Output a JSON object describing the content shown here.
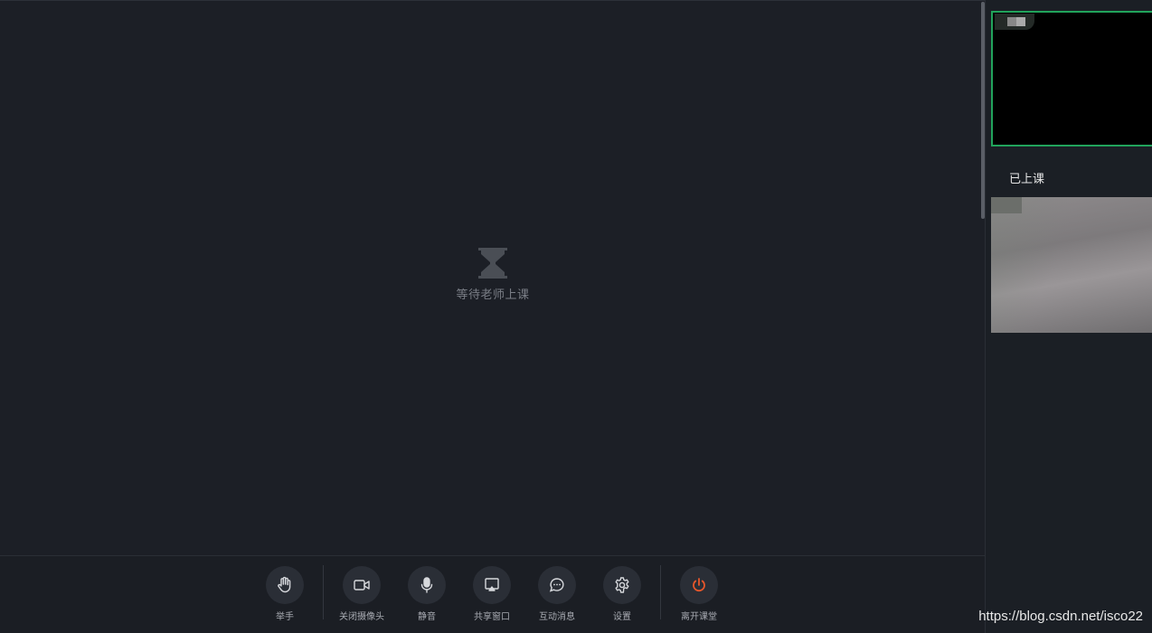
{
  "stage": {
    "waiting_text": "等待老师上课"
  },
  "toolbar": {
    "items": [
      {
        "label": "举手",
        "icon": "hand-icon"
      },
      {
        "label": "关闭摄像头",
        "icon": "camera-icon"
      },
      {
        "label": "静音",
        "icon": "microphone-icon"
      },
      {
        "label": "共享窗口",
        "icon": "screen-share-icon"
      },
      {
        "label": "互动消息",
        "icon": "chat-bubble-icon"
      },
      {
        "label": "设置",
        "icon": "gear-icon"
      },
      {
        "label": "离开课堂",
        "icon": "power-icon"
      }
    ]
  },
  "sidebar": {
    "status_label": "已上课"
  },
  "watermark": "https://blog.csdn.net/isco22",
  "colors": {
    "background": "#1b1f25",
    "active_border": "#21a35b",
    "leave_accent": "#e8572b"
  }
}
